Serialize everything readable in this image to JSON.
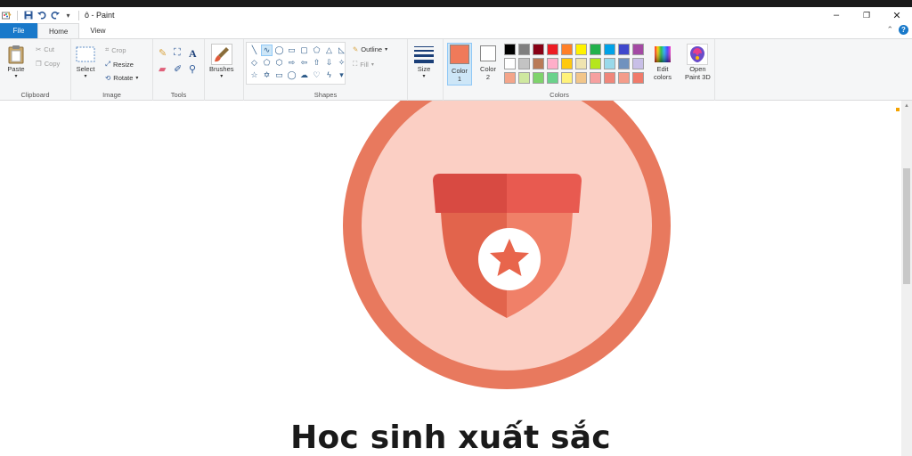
{
  "window": {
    "title": "ô - Paint",
    "controls": {
      "minimize": "–",
      "restore": "❐",
      "close": "✕"
    }
  },
  "quick_access": {
    "save_icon": "save-icon",
    "undo_icon": "undo-icon",
    "redo_icon": "redo-icon",
    "customize": "▾"
  },
  "tabs": [
    {
      "label": "File"
    },
    {
      "label": "Home"
    },
    {
      "label": "View"
    }
  ],
  "ribbon": {
    "clipboard": {
      "group_label": "Clipboard",
      "paste": "Paste",
      "cut": "Cut",
      "copy": "Copy"
    },
    "image": {
      "group_label": "Image",
      "select": "Select",
      "crop": "Crop",
      "resize": "Resize",
      "rotate": "Rotate"
    },
    "tools": {
      "group_label": "Tools"
    },
    "brushes": {
      "label": "Brushes"
    },
    "shapes": {
      "group_label": "Shapes",
      "outline": "Outline",
      "fill": "Fill"
    },
    "size": {
      "label": "Size"
    },
    "colors": {
      "group_label": "Colors",
      "color1": {
        "label": "Color",
        "num": "1",
        "value": "#f07a5a"
      },
      "color2": {
        "label": "Color",
        "num": "2",
        "value": "#ffffff"
      },
      "edit_label": "Edit",
      "edit_label2": "colors",
      "palette": [
        "#000000",
        "#7f7f7f",
        "#880015",
        "#ed1c24",
        "#ff7f27",
        "#fff200",
        "#22b14c",
        "#00a2e8",
        "#3f48cc",
        "#a349a4",
        "#ffffff",
        "#c3c3c3",
        "#b97a57",
        "#ffaec9",
        "#ffc90e",
        "#efe4b0",
        "#b5e61d",
        "#99d9ea",
        "#7092be",
        "#c8bfe7",
        "#f4a58a",
        "#cfe8a0",
        "#7fd36c",
        "#6bd28b",
        "#fff27a",
        "#f2c68a",
        "#f6a0a0",
        "#f0867a",
        "#f49c8a",
        "#f07a6a"
      ]
    },
    "paint3d": {
      "label": "Open",
      "label2": "Paint 3D"
    }
  },
  "canvas": {
    "caption": "Hoc sinh xuất sắc",
    "badge": {
      "outer_ring": "#e8795e",
      "inner_fill": "#fbcfc4",
      "shield_light": "#f08068",
      "shield_dark": "#e2644c",
      "band_dark": "#d84a42",
      "band_light": "#e85a50",
      "star_bg": "#ffffff",
      "star": "#e8654c"
    }
  }
}
